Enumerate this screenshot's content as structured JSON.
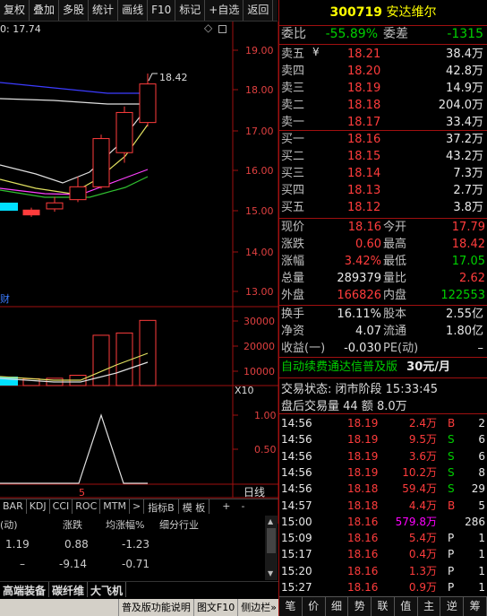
{
  "toolbar": {
    "items": [
      "复权",
      "叠加",
      "多股",
      "统计",
      "画线",
      "F10",
      "标记",
      "+自选",
      "返回"
    ]
  },
  "chart": {
    "cursor_price": "0: 17.74",
    "marker_symbol": "◇",
    "high_label": "18.42",
    "price_ticks": [
      "19.00",
      "18.00",
      "17.00",
      "16.00",
      "15.00",
      "14.00",
      "13.00"
    ],
    "vol_ticks": [
      "30000",
      "20000",
      "10000"
    ],
    "vol_unit": "X10",
    "ind_ticks": [
      "1.00",
      "0.50"
    ],
    "ind_marker": "5",
    "cai_label": "财",
    "day_label": "日线"
  },
  "chart_data": {
    "type": "candlestick",
    "ylim": [
      12.9,
      19.4
    ],
    "candles": [
      {
        "o": 15.02,
        "h": 15.08,
        "l": 14.85,
        "c": 14.9
      },
      {
        "o": 15.05,
        "h": 15.35,
        "l": 14.98,
        "c": 15.2
      },
      {
        "o": 15.28,
        "h": 15.85,
        "l": 15.22,
        "c": 15.6
      },
      {
        "o": 15.6,
        "h": 16.9,
        "l": 15.55,
        "c": 16.8
      },
      {
        "o": 16.45,
        "h": 17.6,
        "l": 16.2,
        "c": 17.45
      },
      {
        "o": 17.2,
        "h": 18.42,
        "l": 17.1,
        "c": 18.16
      }
    ],
    "volumes": [
      3000,
      3200,
      4500,
      22000,
      23000,
      28500
    ],
    "indicator": [
      0,
      0,
      0,
      1.0,
      0,
      0
    ]
  },
  "tabs": {
    "items": [
      "BAR",
      "KDJ",
      "CCI",
      "ROC",
      "MTM",
      ">",
      "指标B",
      "模 板",
      "+",
      "-"
    ]
  },
  "bottom": {
    "headers": [
      "(动)",
      "涨跌",
      "均涨幅%",
      "细分行业"
    ],
    "rows": [
      {
        "a": "1.19",
        "b": "0.88",
        "c": "-1.23"
      },
      {
        "a": "–",
        "b": "-9.14",
        "c": "-0.71"
      }
    ],
    "sector_tabs": [
      "高端装备",
      "碳纤维",
      "大飞机"
    ]
  },
  "statusbar": {
    "items": [
      "普及版功能说明",
      "图文F10",
      "侧边栏»"
    ]
  },
  "stock": {
    "code": "300719",
    "name": "安达维尔"
  },
  "wb": {
    "label": "委比",
    "value": "-55.89%",
    "label2": "委差",
    "value2": "-1315"
  },
  "sells": [
    {
      "l": "卖五",
      "p": "18.21",
      "v": "38.4万"
    },
    {
      "l": "卖四",
      "p": "18.20",
      "v": "42.8万"
    },
    {
      "l": "卖三",
      "p": "18.19",
      "v": "14.9万"
    },
    {
      "l": "卖二",
      "p": "18.18",
      "v": "204.0万"
    },
    {
      "l": "卖一",
      "p": "18.17",
      "v": "33.4万"
    }
  ],
  "buys": [
    {
      "l": "买一",
      "p": "18.16",
      "v": "37.2万"
    },
    {
      "l": "买二",
      "p": "18.15",
      "v": "43.2万"
    },
    {
      "l": "买三",
      "p": "18.14",
      "v": "7.3万"
    },
    {
      "l": "买四",
      "p": "18.13",
      "v": "2.7万"
    },
    {
      "l": "买五",
      "p": "18.12",
      "v": "3.8万"
    }
  ],
  "yen": "¥",
  "stats": [
    {
      "l1": "现价",
      "v1": "18.16",
      "l2": "今开",
      "v2": "17.79"
    },
    {
      "l1": "涨跌",
      "v1": "0.60",
      "l2": "最高",
      "v2": "18.42"
    },
    {
      "l1": "涨幅",
      "v1": "3.42%",
      "l2": "最低",
      "v2": "17.05"
    },
    {
      "l1": "总量",
      "v1": "289379",
      "l2": "量比",
      "v2": "2.62"
    },
    {
      "l1": "外盘",
      "v1": "166826",
      "l2": "内盘",
      "v2": "122553"
    }
  ],
  "fin": [
    {
      "l1": "换手",
      "v1": "16.11%",
      "l2": "股本",
      "v2": "2.55亿"
    },
    {
      "l1": "净资",
      "v1": "4.07",
      "l2": "流通",
      "v2": "1.80亿"
    },
    {
      "l1": "收益(一)",
      "v1": "-0.030",
      "l2": "PE(动)",
      "v2": "–"
    }
  ],
  "ad": {
    "text": "自动续费通达信普及版",
    "price": "30元/月"
  },
  "session": {
    "status": "交易状态: 闭市阶段",
    "time": "15:33:45",
    "after": "盘后交易量 44 额 8.0万"
  },
  "trades": [
    {
      "t": "14:56",
      "p": "18.19",
      "v": "2.4万",
      "d": "B",
      "n": "2"
    },
    {
      "t": "14:56",
      "p": "18.19",
      "v": "9.5万",
      "d": "S",
      "n": "6"
    },
    {
      "t": "14:56",
      "p": "18.19",
      "v": "3.6万",
      "d": "S",
      "n": "6"
    },
    {
      "t": "14:56",
      "p": "18.19",
      "v": "10.2万",
      "d": "S",
      "n": "8"
    },
    {
      "t": "14:56",
      "p": "18.18",
      "v": "59.4万",
      "d": "S",
      "n": "29"
    },
    {
      "t": "14:57",
      "p": "18.18",
      "v": "4.4万",
      "d": "B",
      "n": "5"
    },
    {
      "t": "15:00",
      "p": "18.16",
      "v": "579.8万",
      "d": "",
      "n": "286"
    },
    {
      "t": "15:09",
      "p": "18.16",
      "v": "5.4万",
      "d": "P",
      "n": "1"
    },
    {
      "t": "15:17",
      "p": "18.16",
      "v": "0.4万",
      "d": "P",
      "n": "1"
    },
    {
      "t": "15:20",
      "p": "18.16",
      "v": "1.3万",
      "d": "P",
      "n": "1"
    },
    {
      "t": "15:27",
      "p": "18.16",
      "v": "0.9万",
      "d": "P",
      "n": "1"
    }
  ],
  "bottomtabs": [
    "笔",
    "价",
    "细",
    "势",
    "联",
    "值",
    "主",
    "逆",
    "筹"
  ]
}
